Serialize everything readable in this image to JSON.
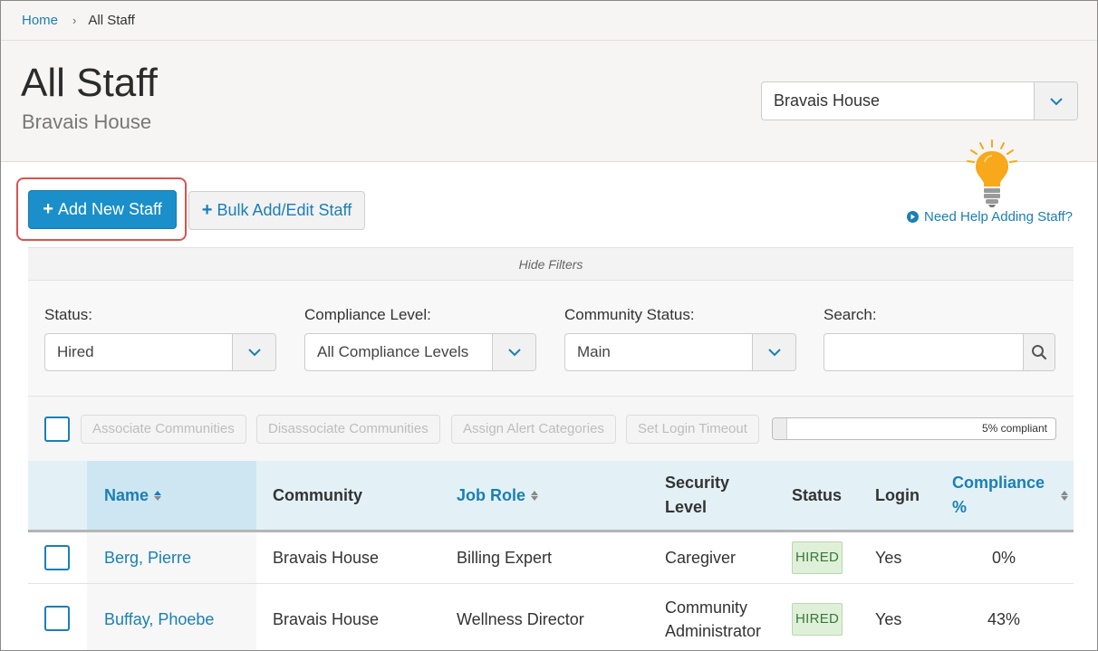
{
  "breadcrumb": {
    "home": "Home",
    "current": "All Staff"
  },
  "header": {
    "title": "All Staff",
    "subtitle": "Bravais House",
    "community_select": "Bravais House"
  },
  "actions": {
    "add_new_staff": "Add New Staff",
    "bulk_add_edit": "Bulk Add/Edit Staff",
    "help_link": "Need Help Adding Staff?"
  },
  "filters": {
    "toggle_label": "Hide Filters",
    "status": {
      "label": "Status:",
      "value": "Hired"
    },
    "compliance": {
      "label": "Compliance Level:",
      "value": "All Compliance Levels"
    },
    "community_status": {
      "label": "Community Status:",
      "value": "Main"
    },
    "search": {
      "label": "Search:",
      "value": ""
    }
  },
  "bulk_actions": {
    "associate": "Associate Communities",
    "disassociate": "Disassociate Communities",
    "assign_alerts": "Assign Alert Categories",
    "login_timeout": "Set Login Timeout"
  },
  "compliance_progress": {
    "percent": 5,
    "label": "5% compliant"
  },
  "table": {
    "columns": {
      "name": "Name",
      "community": "Community",
      "job_role": "Job Role",
      "security_level": "Security Level",
      "status": "Status",
      "login": "Login",
      "compliance": "Compliance %"
    },
    "rows": [
      {
        "name": "Berg, Pierre",
        "community": "Bravais House",
        "job_role": "Billing Expert",
        "security_level": "Caregiver",
        "status": "HIRED",
        "login": "Yes",
        "compliance": "0%"
      },
      {
        "name": "Buffay, Phoebe",
        "community": "Bravais House",
        "job_role": "Wellness Director",
        "security_level": "Community Administrator",
        "status": "HIRED",
        "login": "Yes",
        "compliance": "43%"
      }
    ]
  },
  "colors": {
    "primary": "#1a8fc9",
    "link": "#1a7fb5",
    "highlight": "#d9534f",
    "bulb": "#f7a81b"
  },
  "icons": [
    "chevron-down-icon",
    "plus-icon",
    "lightbulb-icon",
    "play-circle-icon",
    "search-icon",
    "sort-icon",
    "checkbox-icon"
  ]
}
